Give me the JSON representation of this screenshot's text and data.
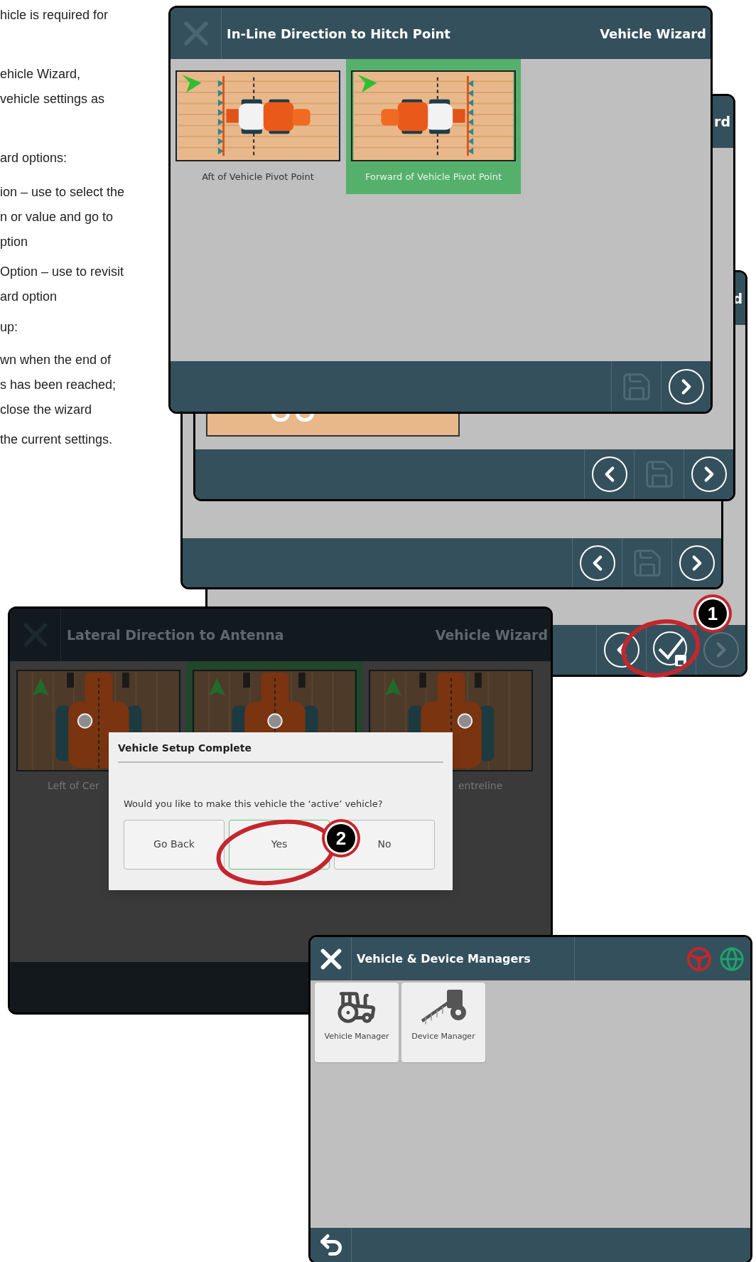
{
  "manual_text": [
    [
      "hicle is required for"
    ],
    [
      "ehicle Wizard,",
      "vehicle settings as"
    ],
    [
      "ard options:"
    ],
    [
      "ion – use to select the",
      "n or value and go to",
      "ption"
    ],
    [
      "Option – use to revisit",
      "ard option"
    ],
    [
      "up:"
    ],
    [
      "wn when the end of",
      "s has been reached;",
      "close the wizard"
    ],
    [
      "the current settings."
    ]
  ],
  "wizard_step_3": {
    "title": "d",
    "buttons": [
      {
        "kind": "back",
        "disabled": false
      },
      {
        "kind": "finish",
        "disabled": false
      },
      {
        "kind": "next",
        "disabled": true
      }
    ],
    "callout": "1"
  },
  "wizard_step_2": {
    "buttons": [
      {
        "kind": "back",
        "disabled": false
      },
      {
        "kind": "save",
        "disabled": true
      },
      {
        "kind": "next",
        "disabled": false
      }
    ]
  },
  "wizard_step_1": {
    "title": "rd",
    "buttons": [
      {
        "kind": "back",
        "disabled": false
      },
      {
        "kind": "save",
        "disabled": true
      },
      {
        "kind": "next",
        "disabled": false
      }
    ]
  },
  "wizard_front": {
    "close_disabled": true,
    "title": "In-Line Direction to Hitch Point",
    "subtitle": "Vehicle Wizard",
    "options": [
      {
        "label": "Aft of Vehicle Pivot Point",
        "selected": false
      },
      {
        "label": "Forward of Vehicle Pivot Point",
        "selected": true
      }
    ],
    "buttons": [
      {
        "kind": "save",
        "disabled": true
      },
      {
        "kind": "next",
        "disabled": false
      }
    ]
  },
  "lateral_window": {
    "title": "Lateral Direction to Antenna",
    "subtitle": "Vehicle Wizard",
    "options": [
      {
        "label": "Left of Cer",
        "selected": false
      },
      {
        "selected": true
      },
      {
        "label": "entreline",
        "selected": false
      }
    ]
  },
  "dialog": {
    "title": "Vehicle Setup Complete",
    "message": "Would you like to make this vehicle the ‘active’ vehicle?",
    "buttons": [
      {
        "label": "Go Back",
        "selected": false
      },
      {
        "label": "Yes",
        "selected": true
      },
      {
        "label": "No",
        "selected": false
      }
    ],
    "callout": "2"
  },
  "managers_window": {
    "title": "Vehicle & Device Managers",
    "status_icons": [
      {
        "kind": "steering",
        "color": "#c0272d"
      },
      {
        "kind": "gnss",
        "color": "#1fa36b"
      }
    ],
    "tiles": [
      {
        "kind": "vehicle",
        "label": "Vehicle Manager"
      },
      {
        "kind": "device",
        "label": "Device Manager"
      }
    ]
  }
}
